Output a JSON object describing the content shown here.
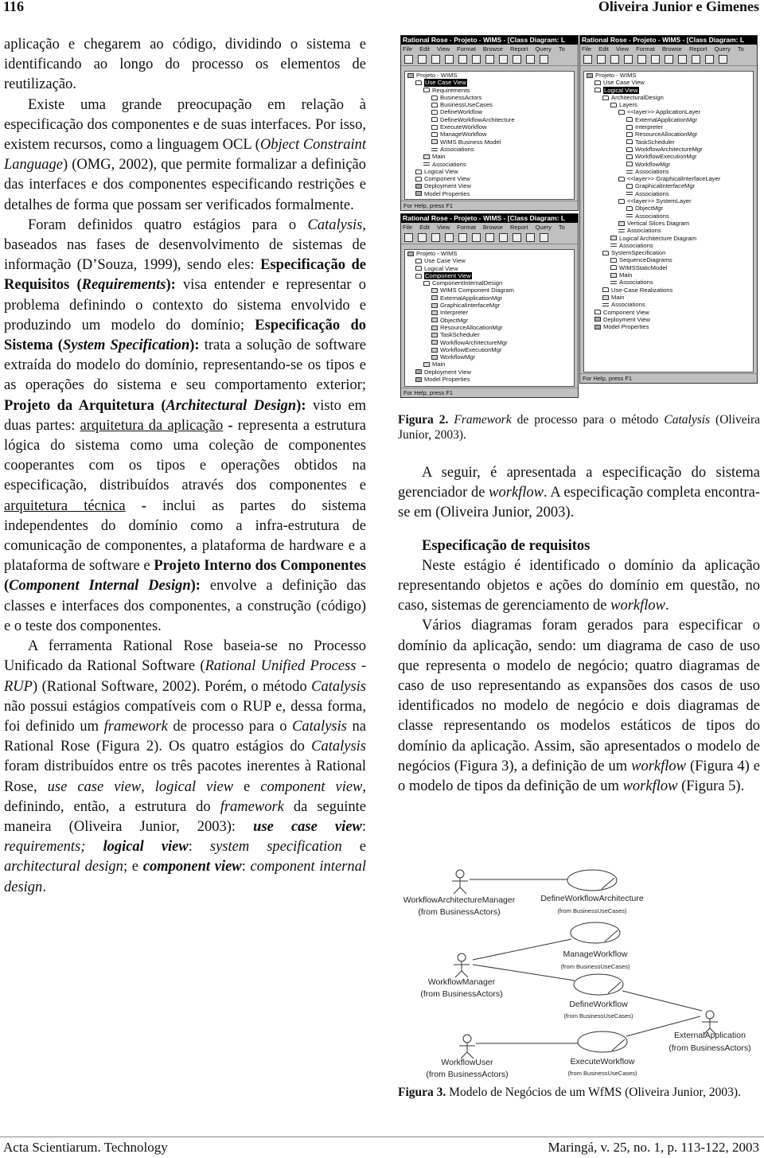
{
  "header": {
    "page_number": "116",
    "authors": "Oliveira Junior e Gimenes"
  },
  "footer": {
    "journal": "Acta Scientiarum. Technology",
    "citation": "Maringá, v. 25, no. 1, p. 113-122, 2003"
  },
  "left": {
    "paragraphs": [
      {
        "indent": false,
        "segments": [
          {
            "t": "aplicação e chegarem ao código, dividindo o sistema e identificando ao longo do processo os elementos de reutilização.",
            "s": ""
          }
        ]
      },
      {
        "indent": true,
        "segments": [
          {
            "t": "Existe uma grande preocupação em relação à especificação dos componentes e de suas interfaces. Por isso, existem recursos, como a linguagem OCL (",
            "s": ""
          },
          {
            "t": "Object Constraint Language",
            "s": "i"
          },
          {
            "t": ") (OMG, 2002), que permite formalizar a definição das interfaces e dos componentes especificando restrições e detalhes de forma que possam ser verificados formalmente.",
            "s": ""
          }
        ]
      },
      {
        "indent": true,
        "segments": [
          {
            "t": "Foram definidos quatro estágios para o ",
            "s": ""
          },
          {
            "t": "Catalysis",
            "s": "i"
          },
          {
            "t": ", baseados nas fases de desenvolvimento de sistemas de informação (D’Souza, 1999), sendo eles: ",
            "s": ""
          },
          {
            "t": "Especificação de Requisitos (",
            "s": "b"
          },
          {
            "t": "Requirements",
            "s": "bi"
          },
          {
            "t": "):",
            "s": "b"
          },
          {
            "t": " visa entender e representar o problema definindo o contexto do sistema envolvido e produzindo um modelo do domínio; ",
            "s": ""
          },
          {
            "t": "Especificação do Sistema (",
            "s": "b"
          },
          {
            "t": "System Specification",
            "s": "bi"
          },
          {
            "t": "):",
            "s": "b"
          },
          {
            "t": " trata a solução de software extraída do modelo do domínio, representando-se os tipos e as operações do sistema e seu comportamento exterior; ",
            "s": ""
          },
          {
            "t": "Projeto da Arquitetura (",
            "s": "b"
          },
          {
            "t": "Architectural Design",
            "s": "bi"
          },
          {
            "t": "):",
            "s": "b"
          },
          {
            "t": " visto em duas partes: ",
            "s": ""
          },
          {
            "t": "arquitetura da aplicação",
            "s": "u"
          },
          {
            "t": " ",
            "s": ""
          },
          {
            "t": "-",
            "s": "b"
          },
          {
            "t": " representa a estrutura lógica do sistema como uma coleção de componentes cooperantes com os tipos e operações obtidos na especificação, distribuídos através dos componentes e ",
            "s": ""
          },
          {
            "t": "arquitetura técnica",
            "s": "u"
          },
          {
            "t": " ",
            "s": ""
          },
          {
            "t": "-",
            "s": "b"
          },
          {
            "t": " inclui as partes do sistema independentes do domínio como a infra-estrutura de comunicação de componentes, a plataforma de hardware e a plataforma de software e ",
            "s": ""
          },
          {
            "t": "Projeto Interno dos Componentes (",
            "s": "b"
          },
          {
            "t": "Component Internal Design",
            "s": "bi"
          },
          {
            "t": "):",
            "s": "b"
          },
          {
            "t": " envolve a definição das classes e interfaces dos componentes, a construção (código) e o teste dos componentes.",
            "s": ""
          }
        ]
      },
      {
        "indent": true,
        "segments": [
          {
            "t": "A ferramenta Rational Rose baseia-se no Processo Unificado da Rational Software (",
            "s": ""
          },
          {
            "t": "Rational Unified Process",
            "s": "i"
          },
          {
            "t": " - ",
            "s": ""
          },
          {
            "t": "RUP",
            "s": "i"
          },
          {
            "t": ") (Rational Software, 2002). Porém, o método ",
            "s": ""
          },
          {
            "t": "Catalysis",
            "s": "i"
          },
          {
            "t": " não possui estágios compatíveis com o RUP e, dessa forma, foi definido um ",
            "s": ""
          },
          {
            "t": "framework",
            "s": "i"
          },
          {
            "t": " de processo para o ",
            "s": ""
          },
          {
            "t": "Catalysis",
            "s": "i"
          },
          {
            "t": " na Rational Rose (Figura 2). Os quatro estágios do ",
            "s": ""
          },
          {
            "t": "Catalysis",
            "s": "i"
          },
          {
            "t": " foram distribuídos entre os três pacotes inerentes à Rational Rose, ",
            "s": ""
          },
          {
            "t": "use case view",
            "s": "i"
          },
          {
            "t": ", ",
            "s": ""
          },
          {
            "t": "logical view",
            "s": "i"
          },
          {
            "t": " e ",
            "s": ""
          },
          {
            "t": "component view",
            "s": "i"
          },
          {
            "t": ", definindo, então, a estrutura do ",
            "s": ""
          },
          {
            "t": "framework",
            "s": "i"
          },
          {
            "t": " da seguinte maneira (Oliveira Junior, 2003): ",
            "s": ""
          },
          {
            "t": "use case view",
            "s": "bi"
          },
          {
            "t": ": ",
            "s": ""
          },
          {
            "t": "requirements; ",
            "s": "i"
          },
          {
            "t": "logical view",
            "s": "bi"
          },
          {
            "t": ": ",
            "s": ""
          },
          {
            "t": "system specification",
            "s": "i"
          },
          {
            "t": " e ",
            "s": ""
          },
          {
            "t": "architectural design",
            "s": "i"
          },
          {
            "t": "; e ",
            "s": ""
          },
          {
            "t": "component view",
            "s": "bi"
          },
          {
            "t": ": ",
            "s": ""
          },
          {
            "t": "component internal design",
            "s": "i"
          },
          {
            "t": ".",
            "s": ""
          }
        ]
      }
    ]
  },
  "figure2": {
    "caption": [
      {
        "t": "Figura 2. ",
        "s": "b"
      },
      {
        "t": "Framework",
        "s": "i"
      },
      {
        "t": " de processo para o método ",
        "s": ""
      },
      {
        "t": "Catalysis",
        "s": "i"
      },
      {
        "t": " (Oliveira Junior, 2003).",
        "s": ""
      }
    ],
    "rose": {
      "title": "Rational Rose - Projeto - WIMS - [Class Diagram: L",
      "menu": [
        "File",
        "Edit",
        "View",
        "Format",
        "Browse",
        "Report",
        "Query",
        "To"
      ],
      "status": "For Help, press F1",
      "windows": [
        {
          "tree": [
            {
              "label": "Projeto - WIMS",
              "depth": 0,
              "icon": "project"
            },
            {
              "label": "Use Case View",
              "depth": 1,
              "icon": "folder",
              "selected": true
            },
            {
              "label": "Requirements",
              "depth": 2,
              "icon": "folder"
            },
            {
              "label": "BusinessActors",
              "depth": 3,
              "icon": "folder"
            },
            {
              "label": "BusinessUseCases",
              "depth": 3,
              "icon": "folder"
            },
            {
              "label": "DefineWorkflow",
              "depth": 3,
              "icon": "folder"
            },
            {
              "label": "DefineWorkflowArchitecture",
              "depth": 3,
              "icon": "folder"
            },
            {
              "label": "ExecuteWorkflow",
              "depth": 3,
              "icon": "folder"
            },
            {
              "label": "ManageWorkflow",
              "depth": 3,
              "icon": "folder"
            },
            {
              "label": "WIMS Business Model",
              "depth": 3,
              "icon": "diagram"
            },
            {
              "label": "Associations",
              "depth": 3,
              "icon": "assoc"
            },
            {
              "label": "Main",
              "depth": 2,
              "icon": "diagram"
            },
            {
              "label": "Associations",
              "depth": 2,
              "icon": "assoc"
            },
            {
              "label": "Logical View",
              "depth": 1,
              "icon": "folder"
            },
            {
              "label": "Component View",
              "depth": 1,
              "icon": "folder"
            },
            {
              "label": "Deployment View",
              "depth": 1,
              "icon": "deploy"
            },
            {
              "label": "Model Properties",
              "depth": 1,
              "icon": "props"
            }
          ]
        },
        {
          "tree": [
            {
              "label": "Projeto - WIMS",
              "depth": 0,
              "icon": "project"
            },
            {
              "label": "Use Case View",
              "depth": 1,
              "icon": "folder"
            },
            {
              "label": "Logical View",
              "depth": 1,
              "icon": "folder",
              "selected": true
            },
            {
              "label": "ArchitecturalDesign",
              "depth": 2,
              "icon": "folder"
            },
            {
              "label": "Layers",
              "depth": 3,
              "icon": "folder"
            },
            {
              "label": "<<layer>> ApplicationLayer",
              "depth": 4,
              "icon": "folder"
            },
            {
              "label": "ExternalApplicationMgr",
              "depth": 5,
              "icon": "folder"
            },
            {
              "label": "Interpreter",
              "depth": 5,
              "icon": "folder"
            },
            {
              "label": "ResourceAllocationMgr",
              "depth": 5,
              "icon": "folder"
            },
            {
              "label": "TaskScheduler",
              "depth": 5,
              "icon": "folder"
            },
            {
              "label": "WorkflowArchitectureMgr",
              "depth": 5,
              "icon": "folder"
            },
            {
              "label": "WorkflowExecutionMgr",
              "depth": 5,
              "icon": "folder"
            },
            {
              "label": "WorkflowMgr",
              "depth": 5,
              "icon": "folder"
            },
            {
              "label": "Associations",
              "depth": 5,
              "icon": "assoc"
            },
            {
              "label": "<<layer>> GraphicalInterfaceLayer",
              "depth": 4,
              "icon": "folder"
            },
            {
              "label": "GraphicalInterfaceMgr",
              "depth": 5,
              "icon": "folder"
            },
            {
              "label": "Associations",
              "depth": 5,
              "icon": "assoc"
            },
            {
              "label": "<<layer>> SystemLayer",
              "depth": 4,
              "icon": "folder"
            },
            {
              "label": "ObjectMgr",
              "depth": 5,
              "icon": "folder"
            },
            {
              "label": "Associations",
              "depth": 5,
              "icon": "assoc"
            },
            {
              "label": "Vertical Slices Diagram",
              "depth": 4,
              "icon": "diagram"
            },
            {
              "label": "Associations",
              "depth": 4,
              "icon": "assoc"
            },
            {
              "label": "Logical Architecture Diagram",
              "depth": 3,
              "icon": "diagram"
            },
            {
              "label": "Associations",
              "depth": 3,
              "icon": "assoc"
            },
            {
              "label": "SystemSpecification",
              "depth": 2,
              "icon": "folder"
            },
            {
              "label": "SequenceDiagrams",
              "depth": 3,
              "icon": "folder"
            },
            {
              "label": "WIMSStaticModel",
              "depth": 3,
              "icon": "folder"
            },
            {
              "label": "Main",
              "depth": 3,
              "icon": "diagram"
            },
            {
              "label": "Associations",
              "depth": 3,
              "icon": "assoc"
            },
            {
              "label": "Use-Case Realizations",
              "depth": 2,
              "icon": "folder"
            },
            {
              "label": "Main",
              "depth": 2,
              "icon": "diagram"
            },
            {
              "label": "Associations",
              "depth": 2,
              "icon": "assoc"
            },
            {
              "label": "Component View",
              "depth": 1,
              "icon": "folder"
            },
            {
              "label": "Deployment View",
              "depth": 1,
              "icon": "deploy"
            },
            {
              "label": "Model Properties",
              "depth": 1,
              "icon": "props"
            }
          ]
        },
        {
          "tree": [
            {
              "label": "Projeto - WIMS",
              "depth": 0,
              "icon": "project"
            },
            {
              "label": "Use Case View",
              "depth": 1,
              "icon": "folder"
            },
            {
              "label": "Logical View",
              "depth": 1,
              "icon": "folder"
            },
            {
              "label": "Component View",
              "depth": 1,
              "icon": "folder",
              "selected": true
            },
            {
              "label": "ComponentInternalDesign",
              "depth": 2,
              "icon": "folder"
            },
            {
              "label": "WIMS Component Diagram",
              "depth": 3,
              "icon": "diagram"
            },
            {
              "label": "ExternalApplicationMgr",
              "depth": 3,
              "icon": "component"
            },
            {
              "label": "GraphicalInterfaceMgr",
              "depth": 3,
              "icon": "component"
            },
            {
              "label": "Interpreter",
              "depth": 3,
              "icon": "component"
            },
            {
              "label": "ObjectMgr",
              "depth": 3,
              "icon": "component"
            },
            {
              "label": "ResourceAllocationMgr",
              "depth": 3,
              "icon": "component"
            },
            {
              "label": "TaskScheduler",
              "depth": 3,
              "icon": "component"
            },
            {
              "label": "WorkflowArchitectureMgr",
              "depth": 3,
              "icon": "component"
            },
            {
              "label": "WorkflowExecutionMgr",
              "depth": 3,
              "icon": "component"
            },
            {
              "label": "WorkflowMgr",
              "depth": 3,
              "icon": "component"
            },
            {
              "label": "Main",
              "depth": 2,
              "icon": "diagram"
            },
            {
              "label": "Deployment View",
              "depth": 1,
              "icon": "deploy"
            },
            {
              "label": "Model Properties",
              "depth": 1,
              "icon": "props"
            }
          ]
        }
      ]
    }
  },
  "right": {
    "intro": [
      {
        "t": "A seguir, é apresentada a especificação do sistema gerenciador de ",
        "s": ""
      },
      {
        "t": "workflow",
        "s": "i"
      },
      {
        "t": ". A especificação completa encontra-se em (Oliveira Junior, 2003).",
        "s": ""
      }
    ],
    "heading": "Especificação de requisitos",
    "p1": [
      {
        "t": "Neste estágio é identificado o domínio da aplicação representando objetos e ações do domínio em questão, no caso, sistemas de gerenciamento de ",
        "s": ""
      },
      {
        "t": "workflow",
        "s": "i"
      },
      {
        "t": ".",
        "s": ""
      }
    ],
    "p2": [
      {
        "t": "Vários diagramas foram gerados para especificar o domínio da aplicação, sendo: um diagrama de caso de uso que representa o modelo de negócio; quatro diagramas de caso de uso representando as expansões dos casos de uso identificados no modelo de negócio e dois diagramas de classe representando os modelos estáticos de tipos do domínio da aplicação. Assim, são apresentados o modelo de negócios (Figura 3), a definição de um ",
        "s": ""
      },
      {
        "t": "workflow",
        "s": "i"
      },
      {
        "t": " (Figura 4) e o modelo de tipos da definição de um ",
        "s": ""
      },
      {
        "t": "workflow",
        "s": "i"
      },
      {
        "t": " (Figura 5).",
        "s": ""
      }
    ]
  },
  "figure3": {
    "caption": [
      {
        "t": "Figura 3.",
        "s": "b"
      },
      {
        "t": " Modelo de Negócios de um WfMS (Oliveira Junior, 2003).",
        "s": ""
      }
    ],
    "actors": [
      {
        "name": "WorkflowArchitectureManager",
        "from": "(from BusinessActors)"
      },
      {
        "name": "WorkflowManager",
        "from": "(from BusinessActors)"
      },
      {
        "name": "ExternalApplication",
        "from": "(from BusinessActors)"
      },
      {
        "name": "WorkflowUser",
        "from": "(from BusinessActors)"
      }
    ],
    "use_cases": [
      {
        "name": "DefineWorkflowArchitecture",
        "from": "(from BusinessUseCases)"
      },
      {
        "name": "ManageWorkflow",
        "from": "(from BusinessUseCases)"
      },
      {
        "name": "DefineWorkflow",
        "from": "(from BusinessUseCases)"
      },
      {
        "name": "ExecuteWorkflow",
        "from": "(from BusinessUseCases)"
      }
    ]
  }
}
